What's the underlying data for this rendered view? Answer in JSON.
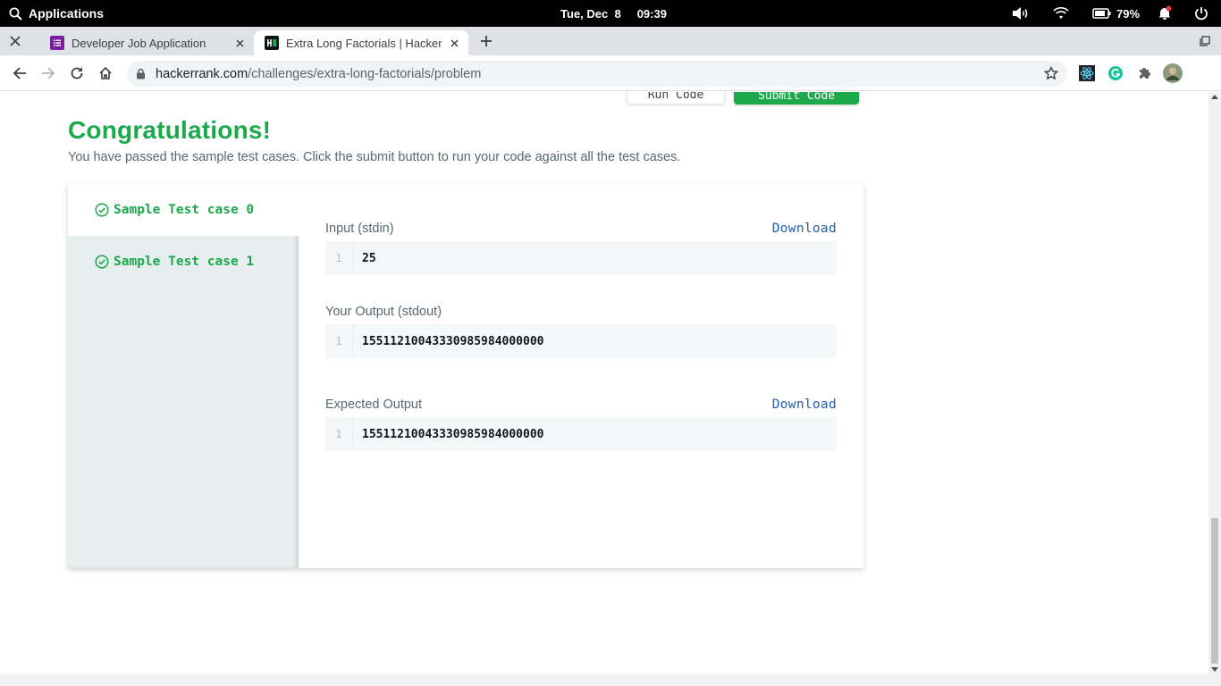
{
  "os": {
    "apps_label": "Applications",
    "date": "Tue, Dec  8",
    "time": "09:39",
    "battery": "79%"
  },
  "tabs": [
    {
      "title": "Developer Job Application",
      "active": false
    },
    {
      "title": "Extra Long Factorials | HackerR",
      "active": true
    }
  ],
  "address": {
    "host": "hackerrank.com",
    "path": "/challenges/extra-long-factorials/problem"
  },
  "page": {
    "run_code_label": "Run Code",
    "submit_code_label": "Submit Code",
    "title": "Congratulations!",
    "subtitle": "You have passed the sample test cases. Click the submit button to run your code against all the test cases.",
    "test_cases": [
      {
        "label": "Sample Test case 0",
        "active": true
      },
      {
        "label": "Sample Test case 1",
        "active": false
      }
    ],
    "input_label": "Input (stdin)",
    "input_line": "1",
    "input_value": "25",
    "output_label": "Your Output (stdout)",
    "output_line": "1",
    "output_value": "15511210043330985984000000",
    "expected_label": "Expected Output",
    "expected_line": "1",
    "expected_value": "15511210043330985984000000",
    "download_label": "Download"
  },
  "colors": {
    "accent_green": "#1ba94c",
    "link_blue": "#1f5fad"
  }
}
